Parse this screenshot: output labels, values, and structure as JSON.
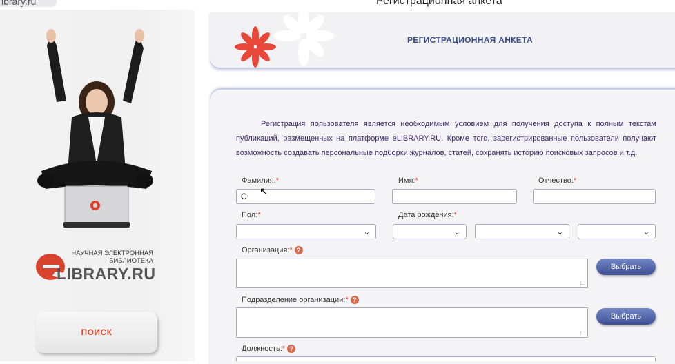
{
  "browser": {
    "tab_url": "ibrary.ru",
    "window_title": "Регистрационная анкета"
  },
  "sidebar": {
    "logo_line1": "НАУЧНАЯ ЭЛЕКТРОННАЯ",
    "logo_line2": "БИБЛИОТЕКА",
    "logo_text": "LIBRARY.RU",
    "search_label": "ПОИСК"
  },
  "header": {
    "title": "РЕГИСТРАЦИОННАЯ АНКЕТА"
  },
  "form": {
    "intro": "Регистрация пользователя является необходимым условием для получения доступа к полным текстам публикаций, размещенных на платформе eLIBRARY.RU. Кроме того, зарегистрированные пользователи получают возможность создавать персональные подборки журналов, статей, сохранять историю поисковых запросов и т.д.",
    "required_mark": "*",
    "help_mark": "?",
    "surname_label": "Фамилия:",
    "surname_value": "С",
    "name_label": "Имя:",
    "patronymic_label": "Отчество:",
    "gender_label": "Пол:",
    "birthdate_label": "Дата рождения:",
    "organization_label": "Организация:",
    "department_label": "Подразделение организации:",
    "position_label": "Должность:",
    "choose_button": "Выбрать"
  },
  "colors": {
    "accent_red": "#d9442f",
    "button_blue": "#3e4f94",
    "title_blue": "#3a4b8c"
  }
}
